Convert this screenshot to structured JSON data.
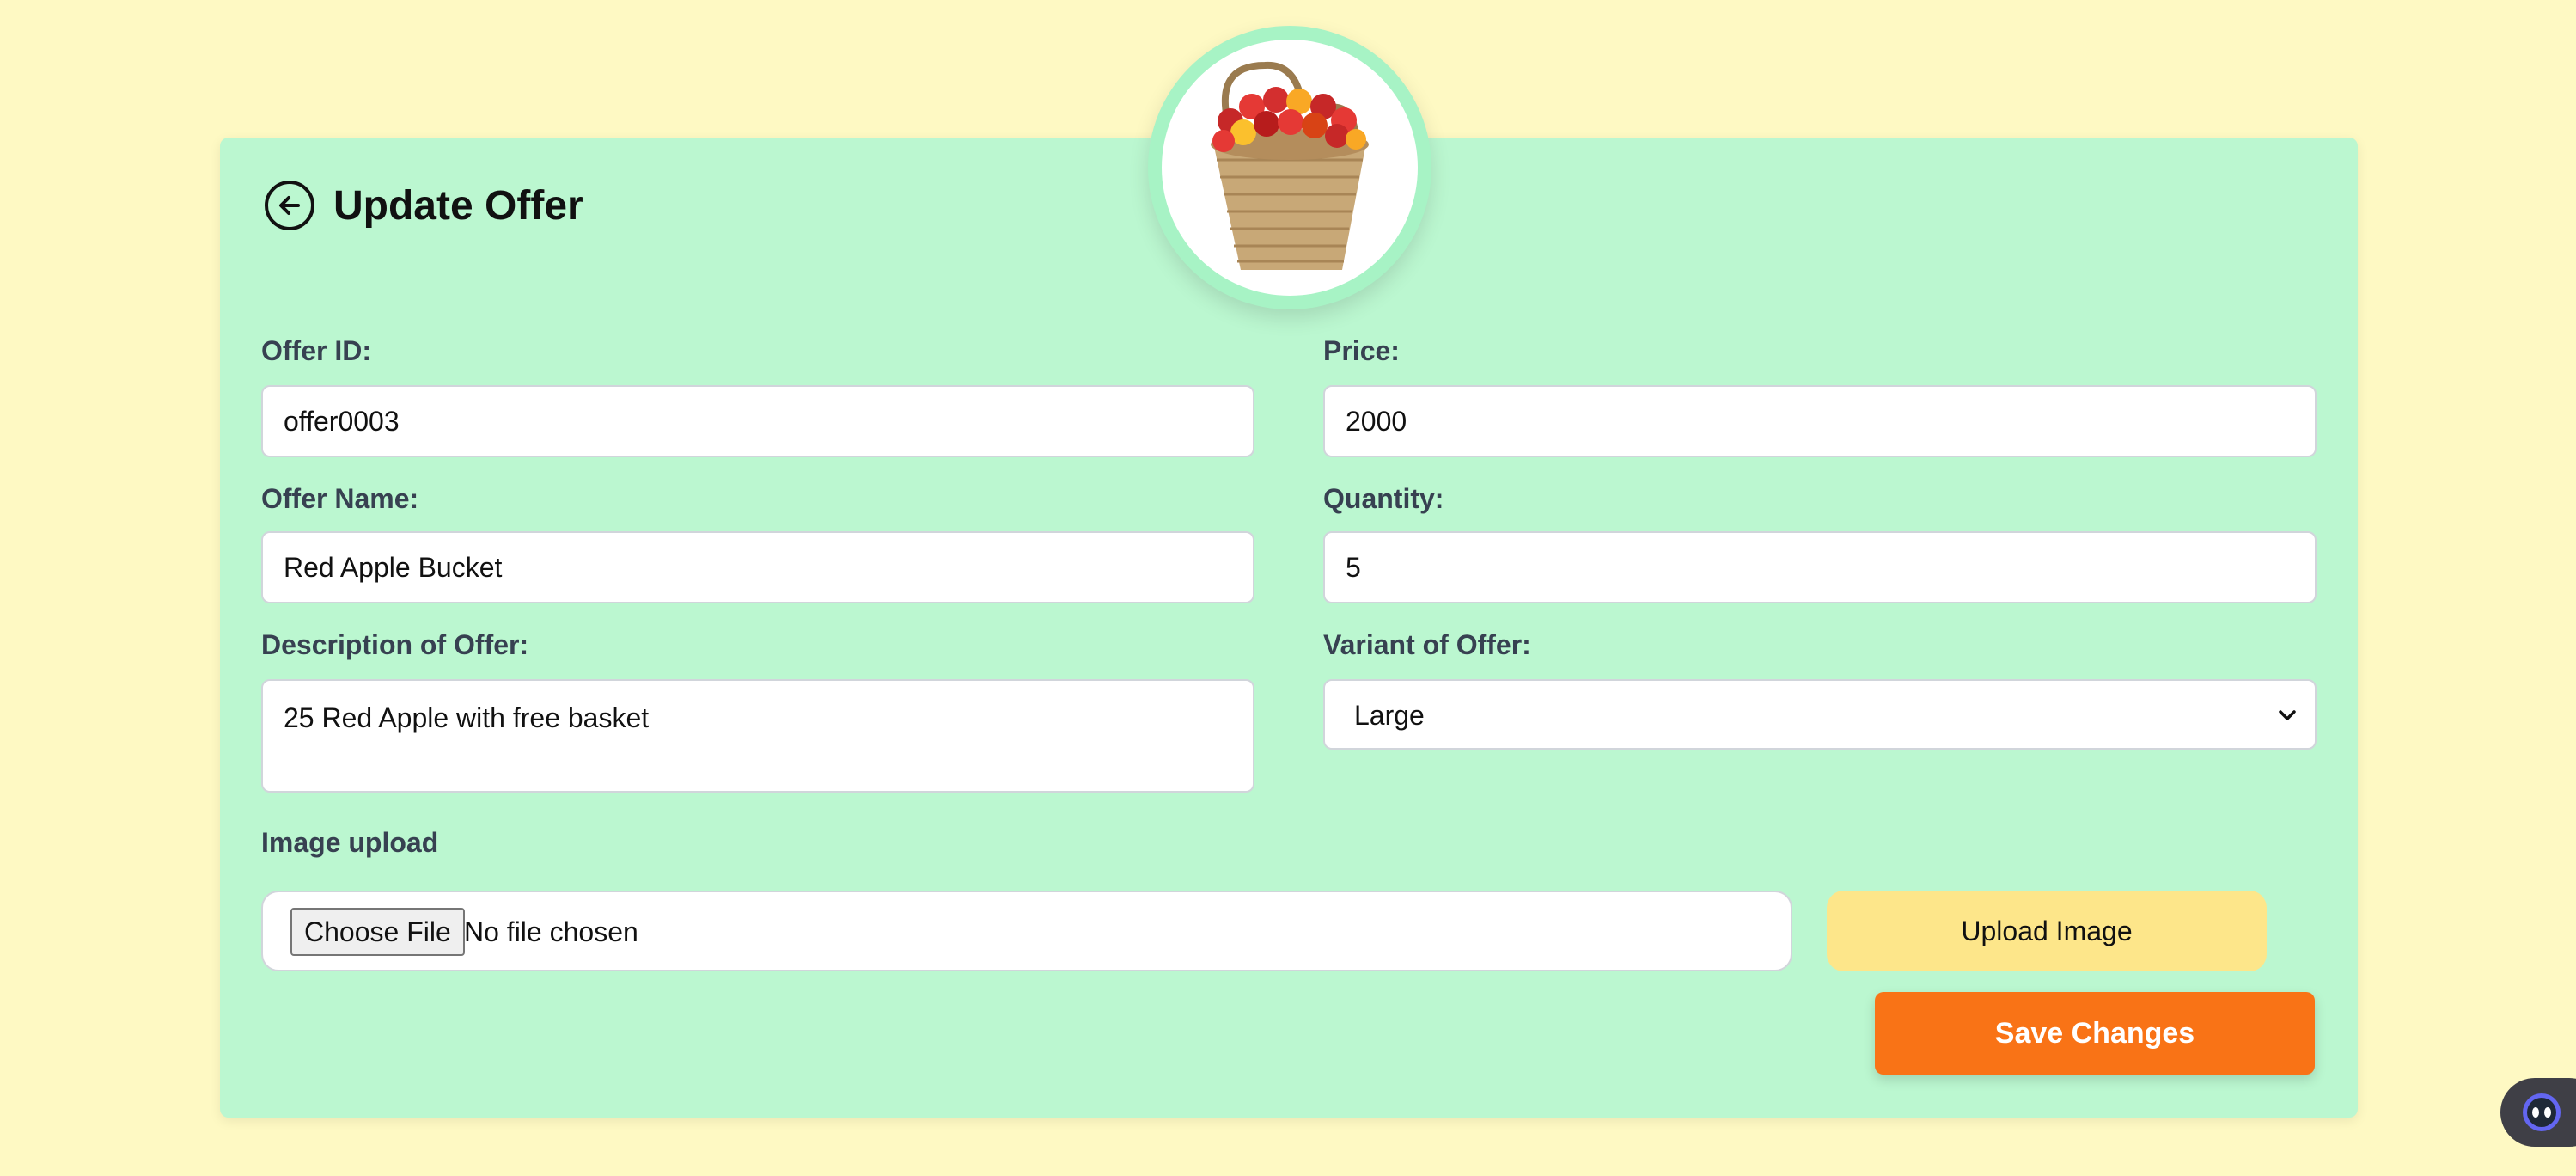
{
  "page": {
    "title": "Update Offer"
  },
  "form": {
    "offer_id": {
      "label": "Offer ID:",
      "value": "offer0003"
    },
    "price": {
      "label": "Price:",
      "value": "2000"
    },
    "offer_name": {
      "label": "Offer Name:",
      "value": "Red Apple Bucket"
    },
    "quantity": {
      "label": "Quantity:",
      "value": "5"
    },
    "description": {
      "label": "Description of Offer:",
      "value": "25 Red Apple with free basket"
    },
    "variant": {
      "label": "Variant of Offer:",
      "selected": "Large"
    },
    "image_upload": {
      "label": "Image upload",
      "choose_label": "Choose File",
      "status": "No file chosen"
    }
  },
  "buttons": {
    "upload": "Upload Image",
    "save": "Save Changes"
  },
  "icons": {
    "back": "arrow-left-circle-icon",
    "product": "apple-basket-image",
    "dropdown": "chevron-down-icon",
    "assistant": "chat-assistant-icon"
  },
  "colors": {
    "background": "#fef9c3",
    "card": "#bbf7d0",
    "upload_button": "#fde68a",
    "save_button": "#f97316"
  }
}
